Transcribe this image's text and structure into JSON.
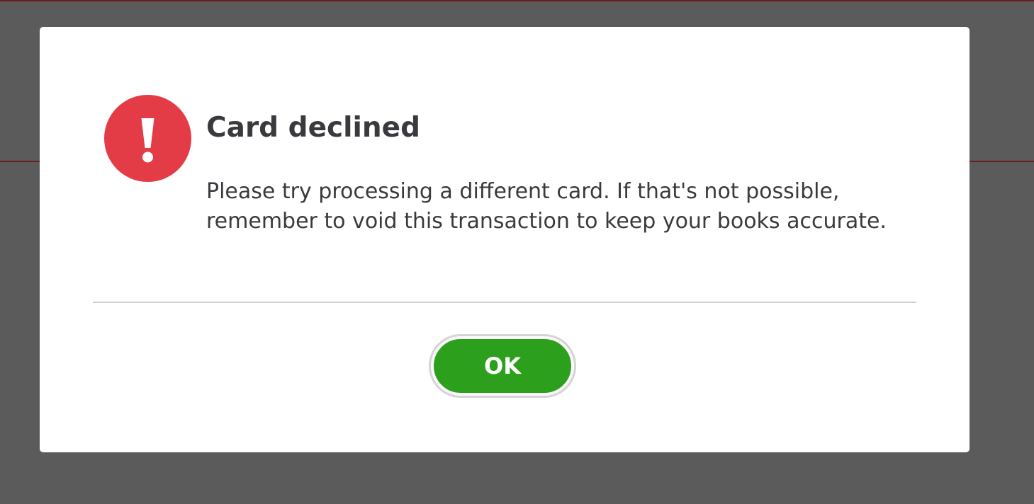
{
  "colors": {
    "backdrop": "#5b5b5c",
    "backdrop_rule": "#6b1d1d",
    "dialog_bg": "#ffffff",
    "alert_red": "#e43c47",
    "ok_green": "#2ca01c",
    "text": "#393a3d"
  },
  "dialog": {
    "icon": "exclamation-alert-icon",
    "title": "Card declined",
    "message": "Please try processing a different card. If that's not possible, remember to void this transaction to keep your books accurate.",
    "ok_label": "OK"
  }
}
